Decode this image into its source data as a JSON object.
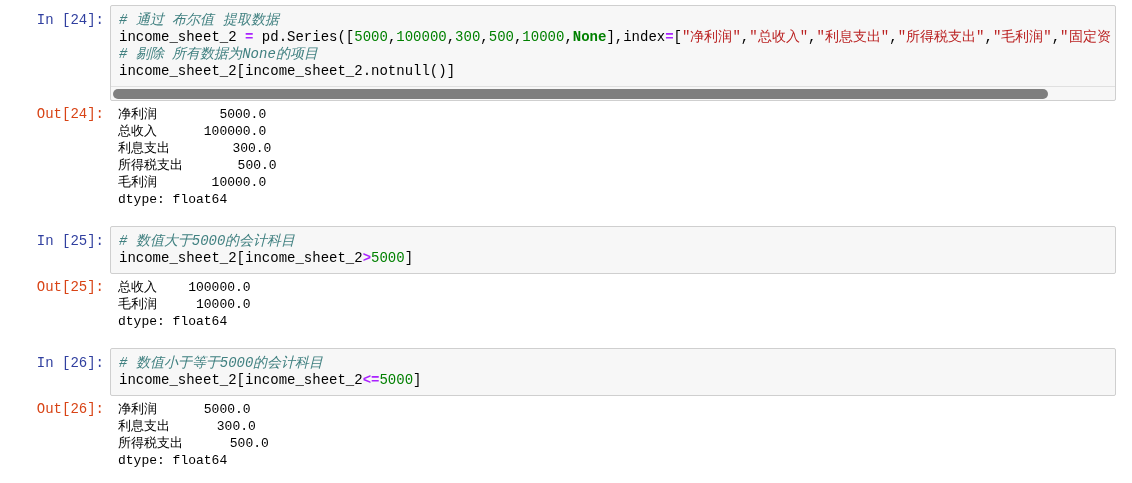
{
  "cells": [
    {
      "input_prompt": "In [24]:",
      "horizontal_scroll": true,
      "code": [
        [
          {
            "kind": "comment",
            "text": "# 通过 布尔值 提取数据"
          }
        ],
        [
          {
            "kind": "text",
            "text": "income_sheet_2 "
          },
          {
            "kind": "op",
            "text": "="
          },
          {
            "kind": "text",
            "text": " pd.Series(["
          },
          {
            "kind": "num",
            "text": "5000"
          },
          {
            "kind": "text",
            "text": ","
          },
          {
            "kind": "num",
            "text": "100000"
          },
          {
            "kind": "text",
            "text": ","
          },
          {
            "kind": "num",
            "text": "300"
          },
          {
            "kind": "text",
            "text": ","
          },
          {
            "kind": "num",
            "text": "500"
          },
          {
            "kind": "text",
            "text": ","
          },
          {
            "kind": "num",
            "text": "10000"
          },
          {
            "kind": "text",
            "text": ","
          },
          {
            "kind": "kw",
            "text": "None"
          },
          {
            "kind": "text",
            "text": "],index"
          },
          {
            "kind": "op",
            "text": "="
          },
          {
            "kind": "text",
            "text": "["
          },
          {
            "kind": "str",
            "text": "\"净利润\""
          },
          {
            "kind": "text",
            "text": ","
          },
          {
            "kind": "str",
            "text": "\"总收入\""
          },
          {
            "kind": "text",
            "text": ","
          },
          {
            "kind": "str",
            "text": "\"利息支出\""
          },
          {
            "kind": "text",
            "text": ","
          },
          {
            "kind": "str",
            "text": "\"所得税支出\""
          },
          {
            "kind": "text",
            "text": ","
          },
          {
            "kind": "str",
            "text": "\"毛利润\""
          },
          {
            "kind": "text",
            "text": ","
          },
          {
            "kind": "str",
            "text": "\"固定资"
          }
        ],
        [
          {
            "kind": "comment",
            "text": "# 剔除 所有数据为None的项目"
          }
        ],
        [
          {
            "kind": "text",
            "text": "income_sheet_2[income_sheet_2.notnull()]"
          }
        ]
      ],
      "output_prompt": "Out[24]:",
      "output": [
        "净利润        5000.0",
        "总收入      100000.0",
        "利息支出        300.0",
        "所得税支出       500.0",
        "毛利润       10000.0",
        "dtype: float64"
      ]
    },
    {
      "input_prompt": "In [25]:",
      "horizontal_scroll": false,
      "code": [
        [
          {
            "kind": "comment",
            "text": "# 数值大于5000的会计科目"
          }
        ],
        [
          {
            "kind": "text",
            "text": "income_sheet_2[income_sheet_2"
          },
          {
            "kind": "op",
            "text": ">"
          },
          {
            "kind": "num",
            "text": "5000"
          },
          {
            "kind": "text",
            "text": "]"
          }
        ]
      ],
      "output_prompt": "Out[25]:",
      "output": [
        "总收入    100000.0",
        "毛利润     10000.0",
        "dtype: float64"
      ]
    },
    {
      "input_prompt": "In [26]:",
      "horizontal_scroll": false,
      "code": [
        [
          {
            "kind": "comment",
            "text": "# 数值小于等于5000的会计科目"
          }
        ],
        [
          {
            "kind": "text",
            "text": "income_sheet_2[income_sheet_2"
          },
          {
            "kind": "op",
            "text": "<="
          },
          {
            "kind": "num",
            "text": "5000"
          },
          {
            "kind": "text",
            "text": "]"
          }
        ]
      ],
      "output_prompt": "Out[26]:",
      "output": [
        "净利润      5000.0",
        "利息支出      300.0",
        "所得税支出      500.0",
        "dtype: float64"
      ]
    }
  ]
}
